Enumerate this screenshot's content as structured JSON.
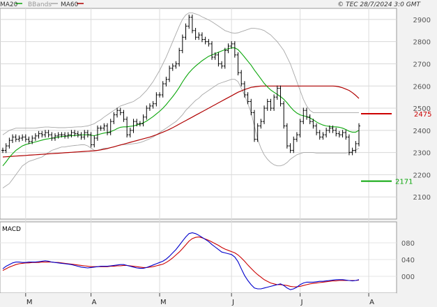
{
  "header": {
    "legend": [
      {
        "label": "MA20",
        "color": "#0aa60a"
      },
      {
        "label": "BBands",
        "color": "#a8a8a8"
      },
      {
        "label": "MA60",
        "color": "#b00000"
      }
    ],
    "source": "© TEC 28/7/2024 3:0 GMT"
  },
  "chart_data": [
    {
      "type": "candlestick",
      "title": "",
      "ylim": [
        2000,
        2950
      ],
      "y_ticks": [
        "2100",
        "2200",
        "2300",
        "2400",
        "2500",
        "2600",
        "2700",
        "2800",
        "2900"
      ],
      "x_ticks": [
        "M",
        "A",
        "M",
        "J",
        "J",
        "A"
      ],
      "grid": true,
      "levels": [
        {
          "label": "2475",
          "value": 2475,
          "color": "#cc0000"
        },
        {
          "label": "2171",
          "value": 2171,
          "color": "#0aa60a"
        }
      ],
      "series": [
        {
          "name": "price",
          "color": "#000000",
          "values": [
            2310,
            2330,
            2355,
            2370,
            2360,
            2365,
            2370,
            2360,
            2350,
            2365,
            2375,
            2385,
            2380,
            2390,
            2380,
            2365,
            2375,
            2380,
            2380,
            2375,
            2380,
            2390,
            2385,
            2380,
            2370,
            2390,
            2380,
            2335,
            2365,
            2410,
            2410,
            2420,
            2390,
            2440,
            2470,
            2490,
            2480,
            2450,
            2380,
            2400,
            2440,
            2430,
            2430,
            2460,
            2500,
            2510,
            2520,
            2560,
            2560,
            2610,
            2630,
            2680,
            2690,
            2700,
            2760,
            2820,
            2870,
            2910,
            2850,
            2820,
            2830,
            2810,
            2800,
            2790,
            2730,
            2740,
            2700,
            2690,
            2760,
            2780,
            2790,
            2740,
            2660,
            2610,
            2560,
            2530,
            2480,
            2360,
            2420,
            2440,
            2500,
            2530,
            2500,
            2550,
            2590,
            2520,
            2420,
            2330,
            2310,
            2360,
            2380,
            2440,
            2490,
            2460,
            2440,
            2420,
            2390,
            2370,
            2380,
            2400,
            2410,
            2400,
            2385,
            2380,
            2390,
            2370,
            2300,
            2310,
            2340,
            2420
          ]
        },
        {
          "name": "MA20",
          "color": "#0aa60a",
          "values": [
            2240,
            2258,
            2278,
            2295,
            2310,
            2320,
            2330,
            2336,
            2340,
            2344,
            2348,
            2352,
            2356,
            2360,
            2362,
            2365,
            2367,
            2370,
            2372,
            2373,
            2375,
            2376,
            2377,
            2378,
            2379,
            2380,
            2380,
            2378,
            2376,
            2380,
            2384,
            2388,
            2390,
            2394,
            2400,
            2408,
            2414,
            2416,
            2416,
            2418,
            2420,
            2424,
            2428,
            2434,
            2442,
            2452,
            2462,
            2474,
            2486,
            2500,
            2516,
            2534,
            2552,
            2572,
            2594,
            2618,
            2640,
            2660,
            2676,
            2690,
            2702,
            2714,
            2724,
            2734,
            2740,
            2746,
            2752,
            2758,
            2764,
            2768,
            2772,
            2772,
            2764,
            2748,
            2730,
            2712,
            2694,
            2672,
            2652,
            2632,
            2612,
            2596,
            2582,
            2572,
            2562,
            2552,
            2540,
            2524,
            2506,
            2490,
            2478,
            2470,
            2466,
            2462,
            2456,
            2448,
            2438,
            2430,
            2424,
            2420,
            2418,
            2416,
            2416,
            2414,
            2410,
            2404,
            2396,
            2392,
            2392,
            2400
          ]
        },
        {
          "name": "MA60",
          "color": "#b00000",
          "values": [
            2280,
            2281,
            2282,
            2283,
            2284,
            2285,
            2286,
            2287,
            2288,
            2289,
            2290,
            2291,
            2292,
            2293,
            2294,
            2295,
            2296,
            2297,
            2298,
            2299,
            2300,
            2301,
            2302,
            2303,
            2304,
            2305,
            2306,
            2307,
            2308,
            2310,
            2312,
            2315,
            2318,
            2322,
            2326,
            2330,
            2334,
            2338,
            2342,
            2346,
            2350,
            2354,
            2358,
            2362,
            2366,
            2370,
            2375,
            2380,
            2386,
            2392,
            2398,
            2405,
            2412,
            2420,
            2428,
            2436,
            2444,
            2452,
            2460,
            2468,
            2476,
            2484,
            2492,
            2500,
            2508,
            2516,
            2524,
            2532,
            2540,
            2548,
            2556,
            2564,
            2572,
            2578,
            2584,
            2589,
            2594,
            2596,
            2598,
            2600,
            2600,
            2600,
            2600,
            2600,
            2600,
            2600,
            2600,
            2600,
            2600,
            2600,
            2600,
            2600,
            2600,
            2600,
            2600,
            2600,
            2600,
            2600,
            2600,
            2600,
            2600,
            2600,
            2599,
            2596,
            2592,
            2586,
            2580,
            2570,
            2558,
            2544
          ]
        },
        {
          "name": "BBand upper",
          "color": "#a8a8a8",
          "values": [
            2380,
            2390,
            2400,
            2405,
            2410,
            2410,
            2410,
            2410,
            2410,
            2410,
            2410,
            2412,
            2414,
            2415,
            2415,
            2414,
            2413,
            2412,
            2412,
            2412,
            2413,
            2414,
            2415,
            2416,
            2416,
            2418,
            2420,
            2425,
            2430,
            2440,
            2448,
            2460,
            2470,
            2480,
            2490,
            2500,
            2510,
            2515,
            2520,
            2525,
            2530,
            2540,
            2550,
            2565,
            2580,
            2600,
            2620,
            2645,
            2670,
            2700,
            2730,
            2765,
            2800,
            2835,
            2870,
            2900,
            2920,
            2930,
            2930,
            2925,
            2920,
            2912,
            2905,
            2898,
            2890,
            2880,
            2870,
            2860,
            2850,
            2845,
            2840,
            2838,
            2840,
            2845,
            2850,
            2855,
            2860,
            2860,
            2858,
            2855,
            2850,
            2840,
            2830,
            2815,
            2800,
            2780,
            2760,
            2730,
            2700,
            2660,
            2620,
            2580,
            2540,
            2510,
            2490,
            2480,
            2480,
            2480,
            2480,
            2480,
            2480,
            2480,
            2480,
            2480,
            2480,
            2480,
            2480,
            2480,
            2480,
            2480
          ]
        },
        {
          "name": "BBand lower",
          "color": "#a8a8a8",
          "values": [
            2140,
            2150,
            2160,
            2180,
            2200,
            2220,
            2240,
            2250,
            2260,
            2265,
            2270,
            2275,
            2280,
            2290,
            2300,
            2310,
            2315,
            2320,
            2325,
            2325,
            2328,
            2330,
            2332,
            2333,
            2335,
            2335,
            2330,
            2320,
            2310,
            2310,
            2315,
            2320,
            2320,
            2322,
            2325,
            2330,
            2335,
            2336,
            2336,
            2338,
            2340,
            2342,
            2345,
            2350,
            2356,
            2362,
            2370,
            2380,
            2390,
            2400,
            2410,
            2420,
            2430,
            2440,
            2455,
            2470,
            2490,
            2505,
            2520,
            2535,
            2545,
            2560,
            2570,
            2580,
            2590,
            2600,
            2610,
            2615,
            2620,
            2625,
            2630,
            2630,
            2620,
            2590,
            2560,
            2520,
            2480,
            2420,
            2360,
            2320,
            2290,
            2270,
            2255,
            2245,
            2240,
            2240,
            2245,
            2255,
            2270,
            2280,
            2290,
            2295,
            2300,
            2300,
            2300,
            2300,
            2298,
            2298,
            2298,
            2298,
            2298,
            2298,
            2298,
            2298,
            2298,
            2298,
            2300,
            2305,
            2310,
            2320
          ]
        }
      ]
    },
    {
      "type": "line",
      "title": "MACD",
      "ylim": [
        -40,
        130
      ],
      "y_ticks": [
        "000",
        "040",
        "080"
      ],
      "series": [
        {
          "name": "MACD",
          "color": "#0000cc",
          "values": [
            18,
            24,
            28,
            32,
            34,
            34,
            33,
            33,
            34,
            34,
            34,
            35,
            36,
            37,
            36,
            34,
            33,
            32,
            31,
            30,
            29,
            28,
            26,
            24,
            22,
            21,
            20,
            21,
            22,
            23,
            24,
            24,
            24,
            25,
            26,
            27,
            28,
            28,
            26,
            24,
            22,
            20,
            19,
            19,
            21,
            24,
            27,
            30,
            33,
            36,
            41,
            48,
            56,
            64,
            74,
            84,
            94,
            102,
            104,
            102,
            98,
            93,
            88,
            83,
            76,
            70,
            64,
            58,
            56,
            54,
            52,
            46,
            35,
            18,
            2,
            -10,
            -20,
            -28,
            -30,
            -30,
            -28,
            -26,
            -24,
            -22,
            -20,
            -18,
            -22,
            -28,
            -32,
            -30,
            -26,
            -20,
            -16,
            -14,
            -14,
            -14,
            -13,
            -12,
            -12,
            -11,
            -10,
            -9,
            -8,
            -8,
            -8,
            -9,
            -10,
            -11,
            -10,
            -8
          ]
        },
        {
          "name": "Signal",
          "color": "#cc0000",
          "values": [
            14,
            18,
            22,
            25,
            28,
            30,
            31,
            32,
            32,
            33,
            33,
            33,
            34,
            34,
            34,
            34,
            33,
            33,
            32,
            31,
            30,
            29,
            28,
            27,
            26,
            25,
            24,
            23,
            23,
            23,
            23,
            23,
            23,
            24,
            24,
            25,
            25,
            26,
            26,
            25,
            24,
            23,
            22,
            21,
            21,
            22,
            23,
            25,
            27,
            29,
            33,
            38,
            44,
            51,
            58,
            66,
            75,
            84,
            90,
            93,
            94,
            92,
            89,
            86,
            82,
            78,
            74,
            69,
            65,
            62,
            59,
            56,
            51,
            44,
            36,
            27,
            19,
            11,
            4,
            -2,
            -8,
            -12,
            -16,
            -18,
            -20,
            -20,
            -21,
            -22,
            -24,
            -25,
            -25,
            -24,
            -22,
            -20,
            -18,
            -17,
            -16,
            -15,
            -14,
            -13,
            -12,
            -11,
            -11,
            -10,
            -10,
            -10,
            -10,
            -10,
            -10,
            -9
          ]
        }
      ]
    }
  ]
}
